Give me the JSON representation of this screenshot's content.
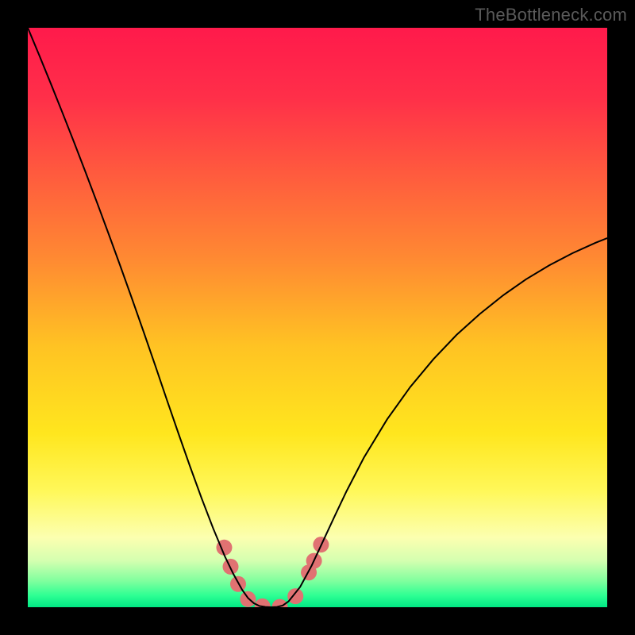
{
  "watermark": "TheBottleneck.com",
  "chart_data": {
    "type": "line",
    "title": "",
    "xlabel": "",
    "ylabel": "",
    "xlim": [
      0,
      100
    ],
    "ylim": [
      0,
      100
    ],
    "background_gradient": {
      "stops": [
        {
          "offset": 0.0,
          "color": "#ff1a4b"
        },
        {
          "offset": 0.12,
          "color": "#ff2f49"
        },
        {
          "offset": 0.25,
          "color": "#ff5a3e"
        },
        {
          "offset": 0.4,
          "color": "#ff8a32"
        },
        {
          "offset": 0.55,
          "color": "#ffc323"
        },
        {
          "offset": 0.7,
          "color": "#ffe61e"
        },
        {
          "offset": 0.8,
          "color": "#fff85a"
        },
        {
          "offset": 0.88,
          "color": "#fcffb0"
        },
        {
          "offset": 0.92,
          "color": "#d4ffb0"
        },
        {
          "offset": 0.955,
          "color": "#7fff9e"
        },
        {
          "offset": 0.98,
          "color": "#2dff93"
        },
        {
          "offset": 1.0,
          "color": "#00e884"
        }
      ]
    },
    "series": [
      {
        "name": "curve",
        "color": "#000000",
        "width": 2.0,
        "x": [
          0,
          2,
          4,
          6,
          8,
          10,
          12,
          14,
          16,
          18,
          20,
          22,
          24,
          26,
          28,
          30,
          32,
          34,
          35.5,
          37,
          38,
          39,
          40,
          41,
          42,
          43,
          44,
          45,
          47,
          49,
          51,
          53,
          55,
          58,
          62,
          66,
          70,
          74,
          78,
          82,
          86,
          90,
          94,
          98,
          100
        ],
        "y": [
          100,
          95.2,
          90.3,
          85.3,
          80.2,
          75.0,
          69.7,
          64.3,
          58.8,
          53.2,
          47.5,
          41.7,
          35.8,
          30.0,
          24.3,
          18.8,
          13.6,
          8.8,
          5.7,
          3.0,
          1.6,
          0.7,
          0.2,
          0.05,
          0.0,
          0.05,
          0.3,
          1.0,
          3.5,
          7.2,
          11.5,
          15.8,
          20.0,
          25.8,
          32.4,
          38.0,
          42.8,
          47.0,
          50.6,
          53.8,
          56.6,
          59.0,
          61.1,
          62.9,
          63.7
        ]
      },
      {
        "name": "markers",
        "color": "#e07272",
        "marker_radius": 10,
        "points": [
          {
            "x": 33.9,
            "y": 10.3
          },
          {
            "x": 35.0,
            "y": 7.0
          },
          {
            "x": 36.3,
            "y": 4.0
          },
          {
            "x": 38.0,
            "y": 1.4
          },
          {
            "x": 40.5,
            "y": 0.15
          },
          {
            "x": 43.5,
            "y": 0.05
          },
          {
            "x": 46.2,
            "y": 1.9
          },
          {
            "x": 48.5,
            "y": 6.0
          },
          {
            "x": 49.4,
            "y": 8.0
          },
          {
            "x": 50.6,
            "y": 10.8
          }
        ]
      }
    ]
  }
}
